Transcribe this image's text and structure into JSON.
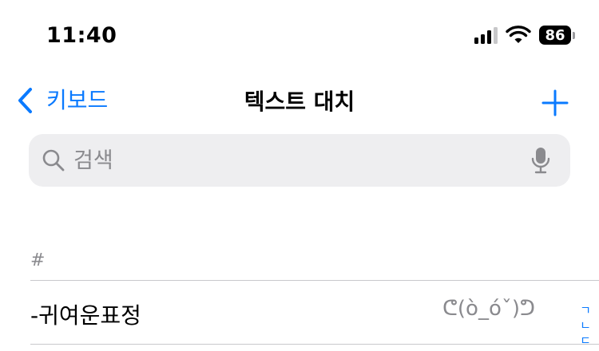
{
  "status_bar": {
    "time": "11:40",
    "battery_percent": "86",
    "signal_bars_active": 3,
    "icons": [
      "signal-icon",
      "wifi-icon",
      "battery-icon"
    ]
  },
  "nav": {
    "back_label": "키보드",
    "title": "텍스트 대치",
    "add_icon": "plus-icon"
  },
  "search": {
    "placeholder": "검색",
    "value": ""
  },
  "section": {
    "header": "#"
  },
  "rows": [
    {
      "phrase": "-귀여운표정",
      "shortcut": "ᕦ(ò_óˇ)ᕤ"
    }
  ],
  "index": [
    "ㄱ",
    "ㄴ",
    "ㄷ"
  ],
  "colors": {
    "accent": "#0a7aff",
    "secondary_text": "#8a8a8e",
    "search_bg": "#eeeef0"
  }
}
